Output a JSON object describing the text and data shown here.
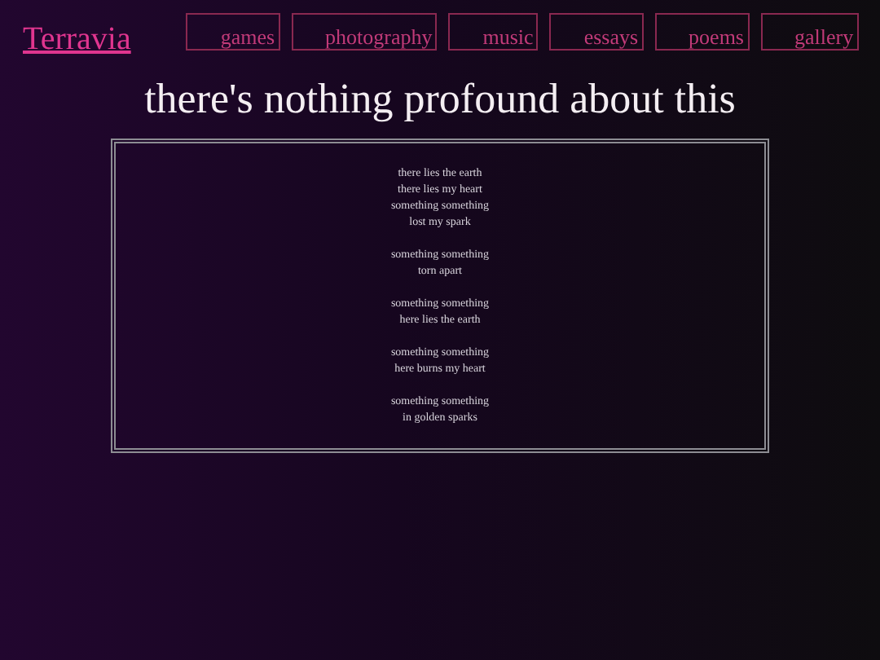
{
  "site_title": "Terravia",
  "nav": [
    "games",
    "photography",
    "music",
    "essays",
    "poems",
    "gallery"
  ],
  "heading": "there's nothing profound about this",
  "stanzas": [
    [
      "there lies the earth",
      "there lies my heart",
      "something something",
      "lost my spark"
    ],
    [
      "something something",
      "torn apart"
    ],
    [
      "something something",
      "here lies the earth"
    ],
    [
      "something something",
      "here burns my heart"
    ],
    [
      "something something",
      "in golden sparks"
    ]
  ]
}
